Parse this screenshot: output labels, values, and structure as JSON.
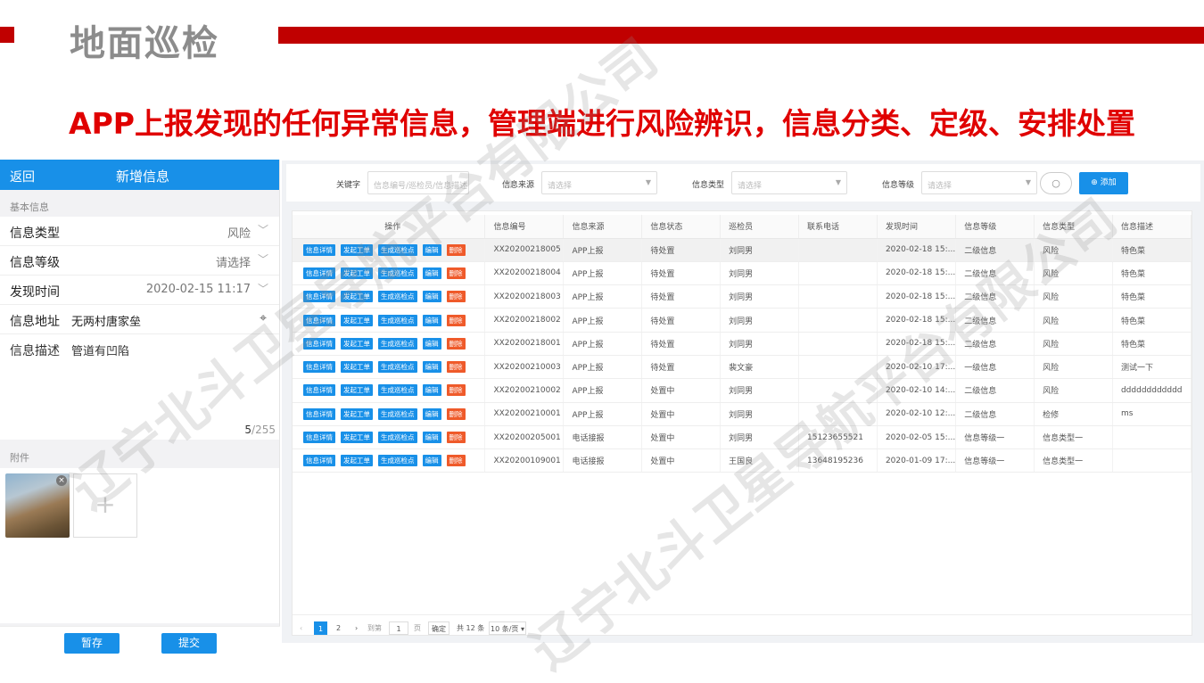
{
  "slide": {
    "title": "地面巡检",
    "headline": "APP上报发现的任何异常信息，管理端进行风险辨识，信息分类、定级、安排处置",
    "watermark": "辽宁北斗卫星导航平台有限公司"
  },
  "mobile": {
    "back": "返回",
    "title": "新增信息",
    "section_basic": "基本信息",
    "fields": {
      "type_label": "信息类型",
      "type_value": "风险",
      "level_label": "信息等级",
      "level_value": "请选择",
      "time_label": "发现时间",
      "time_value": "2020-02-15 11:17",
      "addr_label": "信息地址",
      "addr_value": "无两村唐家垒",
      "desc_label": "信息描述",
      "desc_value": "管道有凹陷",
      "count_current": "5",
      "count_total": "/255"
    },
    "section_attach": "附件",
    "save_label": "暂存",
    "submit_label": "提交"
  },
  "filter": {
    "keyword_label": "关键字",
    "keyword_placeholder": "信息编号/巡检员/信息描述",
    "source_label": "信息来源",
    "source_placeholder": "请选择",
    "type_label": "信息类型",
    "type_placeholder": "请选择",
    "level_label": "信息等级",
    "level_placeholder": "请选择",
    "add_label": "添加"
  },
  "table": {
    "headers": [
      "操作",
      "信息编号",
      "信息来源",
      "信息状态",
      "巡检员",
      "联系电话",
      "发现时间",
      "信息等级",
      "信息类型",
      "信息描述"
    ],
    "actions": [
      "信息详情",
      "发起工单",
      "生成巡检点",
      "编辑",
      "删除"
    ],
    "rows": [
      [
        "XX20200218005",
        "APP上报",
        "待处置",
        "刘同男",
        "",
        "2020-02-18 15:...",
        "二级信息",
        "风险",
        "特色菜"
      ],
      [
        "XX20200218004",
        "APP上报",
        "待处置",
        "刘同男",
        "",
        "2020-02-18 15:...",
        "二级信息",
        "风险",
        "特色菜"
      ],
      [
        "XX20200218003",
        "APP上报",
        "待处置",
        "刘同男",
        "",
        "2020-02-18 15:...",
        "二级信息",
        "风险",
        "特色菜"
      ],
      [
        "XX20200218002",
        "APP上报",
        "待处置",
        "刘同男",
        "",
        "2020-02-18 15:...",
        "二级信息",
        "风险",
        "特色菜"
      ],
      [
        "XX20200218001",
        "APP上报",
        "待处置",
        "刘同男",
        "",
        "2020-02-18 15:...",
        "二级信息",
        "风险",
        "特色菜"
      ],
      [
        "XX20200210003",
        "APP上报",
        "待处置",
        "裴文豪",
        "",
        "2020-02-10 17:...",
        "一级信息",
        "风险",
        "测试一下"
      ],
      [
        "XX20200210002",
        "APP上报",
        "处置中",
        "刘同男",
        "",
        "2020-02-10 14:...",
        "二级信息",
        "风险",
        "dddddddddddd"
      ],
      [
        "XX20200210001",
        "APP上报",
        "处置中",
        "刘同男",
        "",
        "2020-02-10 12:...",
        "二级信息",
        "检修",
        "ms"
      ],
      [
        "XX20200205001",
        "电话接报",
        "处置中",
        "刘同男",
        "15123655521",
        "2020-02-05 15:...",
        "信息等级一",
        "信息类型一",
        ""
      ],
      [
        "XX20200109001",
        "电话接报",
        "处置中",
        "王国良",
        "13648195236",
        "2020-01-09 17:...",
        "信息等级一",
        "信息类型一",
        ""
      ]
    ]
  },
  "pager": {
    "page1": "1",
    "page2": "2",
    "goto_label": "到第",
    "goto_value": "1",
    "page_unit": "页",
    "confirm": "确定",
    "total": "共 12 条",
    "size": "10 条/页"
  }
}
